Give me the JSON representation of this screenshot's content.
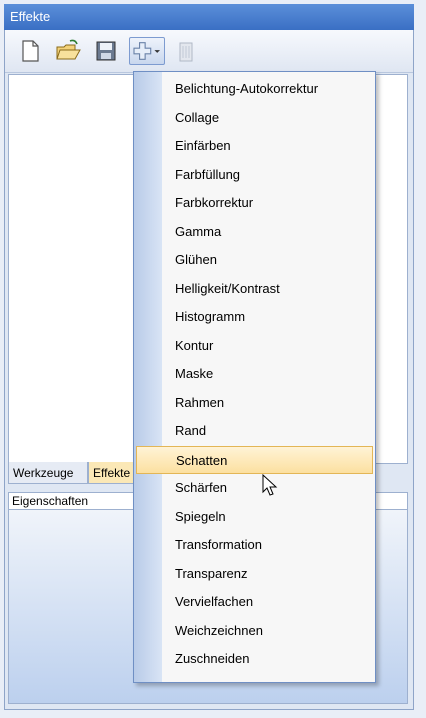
{
  "window": {
    "title": "Effekte"
  },
  "toolbar": {
    "buttons": [
      {
        "name": "new",
        "icon": "new-document-icon"
      },
      {
        "name": "open",
        "icon": "open-folder-icon"
      },
      {
        "name": "save",
        "icon": "save-disk-icon"
      },
      {
        "name": "add",
        "icon": "add-dropdown-icon"
      },
      {
        "name": "delete",
        "icon": "trash-icon"
      }
    ]
  },
  "tabs": [
    {
      "label": "Werkzeuge"
    },
    {
      "label": "Effekte"
    }
  ],
  "properties": {
    "header": "Eigenschaften"
  },
  "menu": {
    "items": [
      {
        "label": "Belichtung-Autokorrektur"
      },
      {
        "label": "Collage"
      },
      {
        "label": "Einfärben"
      },
      {
        "label": "Farbfüllung"
      },
      {
        "label": "Farbkorrektur"
      },
      {
        "label": "Gamma"
      },
      {
        "label": "Glühen"
      },
      {
        "label": "Helligkeit/Kontrast"
      },
      {
        "label": "Histogramm"
      },
      {
        "label": "Kontur"
      },
      {
        "label": "Maske"
      },
      {
        "label": "Rahmen"
      },
      {
        "label": "Rand"
      },
      {
        "label": "Schatten"
      },
      {
        "label": "Schärfen"
      },
      {
        "label": "Spiegeln"
      },
      {
        "label": "Transformation"
      },
      {
        "label": "Transparenz"
      },
      {
        "label": "Vervielfachen"
      },
      {
        "label": "Weichzeichnen"
      },
      {
        "label": "Zuschneiden"
      }
    ],
    "highlighted": "Schatten"
  },
  "colors": {
    "titlebar": "#4a80d2",
    "highlight": "#fce0a0",
    "selected_tab": "#fbe8b6"
  }
}
